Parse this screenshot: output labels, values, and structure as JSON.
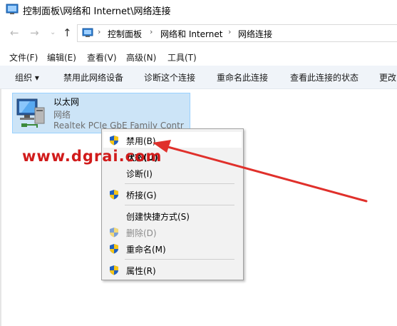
{
  "window": {
    "title": "控制面板\\网络和 Internet\\网络连接"
  },
  "address_bar": {
    "breadcrumbs": [
      "控制面板",
      "网络和 Internet",
      "网络连接"
    ]
  },
  "menu_bar": {
    "items": [
      "文件(F)",
      "编辑(E)",
      "查看(V)",
      "高级(N)",
      "工具(T)"
    ]
  },
  "command_bar": {
    "organize": "组织 ▾",
    "commands": [
      "禁用此网络设备",
      "诊断这个连接",
      "重命名此连接",
      "查看此连接的状态",
      "更改"
    ]
  },
  "connection": {
    "name": "以太网",
    "status": "网络",
    "device": "Realtek PCIe GbE Family Contr"
  },
  "context_menu": {
    "items": [
      {
        "label": "禁用(B)",
        "shield": true,
        "state": "hover"
      },
      {
        "label": "状态(U)",
        "shield": false,
        "state": "bold"
      },
      {
        "label": "诊断(I)",
        "shield": false,
        "state": "normal"
      },
      {
        "label": "桥接(G)",
        "shield": true,
        "state": "normal"
      },
      {
        "label": "创建快捷方式(S)",
        "shield": false,
        "state": "normal"
      },
      {
        "label": "删除(D)",
        "shield": true,
        "state": "disabled"
      },
      {
        "label": "重命名(M)",
        "shield": true,
        "state": "normal"
      },
      {
        "label": "属性(R)",
        "shield": true,
        "state": "normal"
      }
    ]
  },
  "watermark": "www.dgrai.com",
  "colors": {
    "selection": "#cce4f7",
    "command_bar": "#f0f4f9",
    "menu_background": "#f2f2f2",
    "arrow": "#e0302b"
  }
}
